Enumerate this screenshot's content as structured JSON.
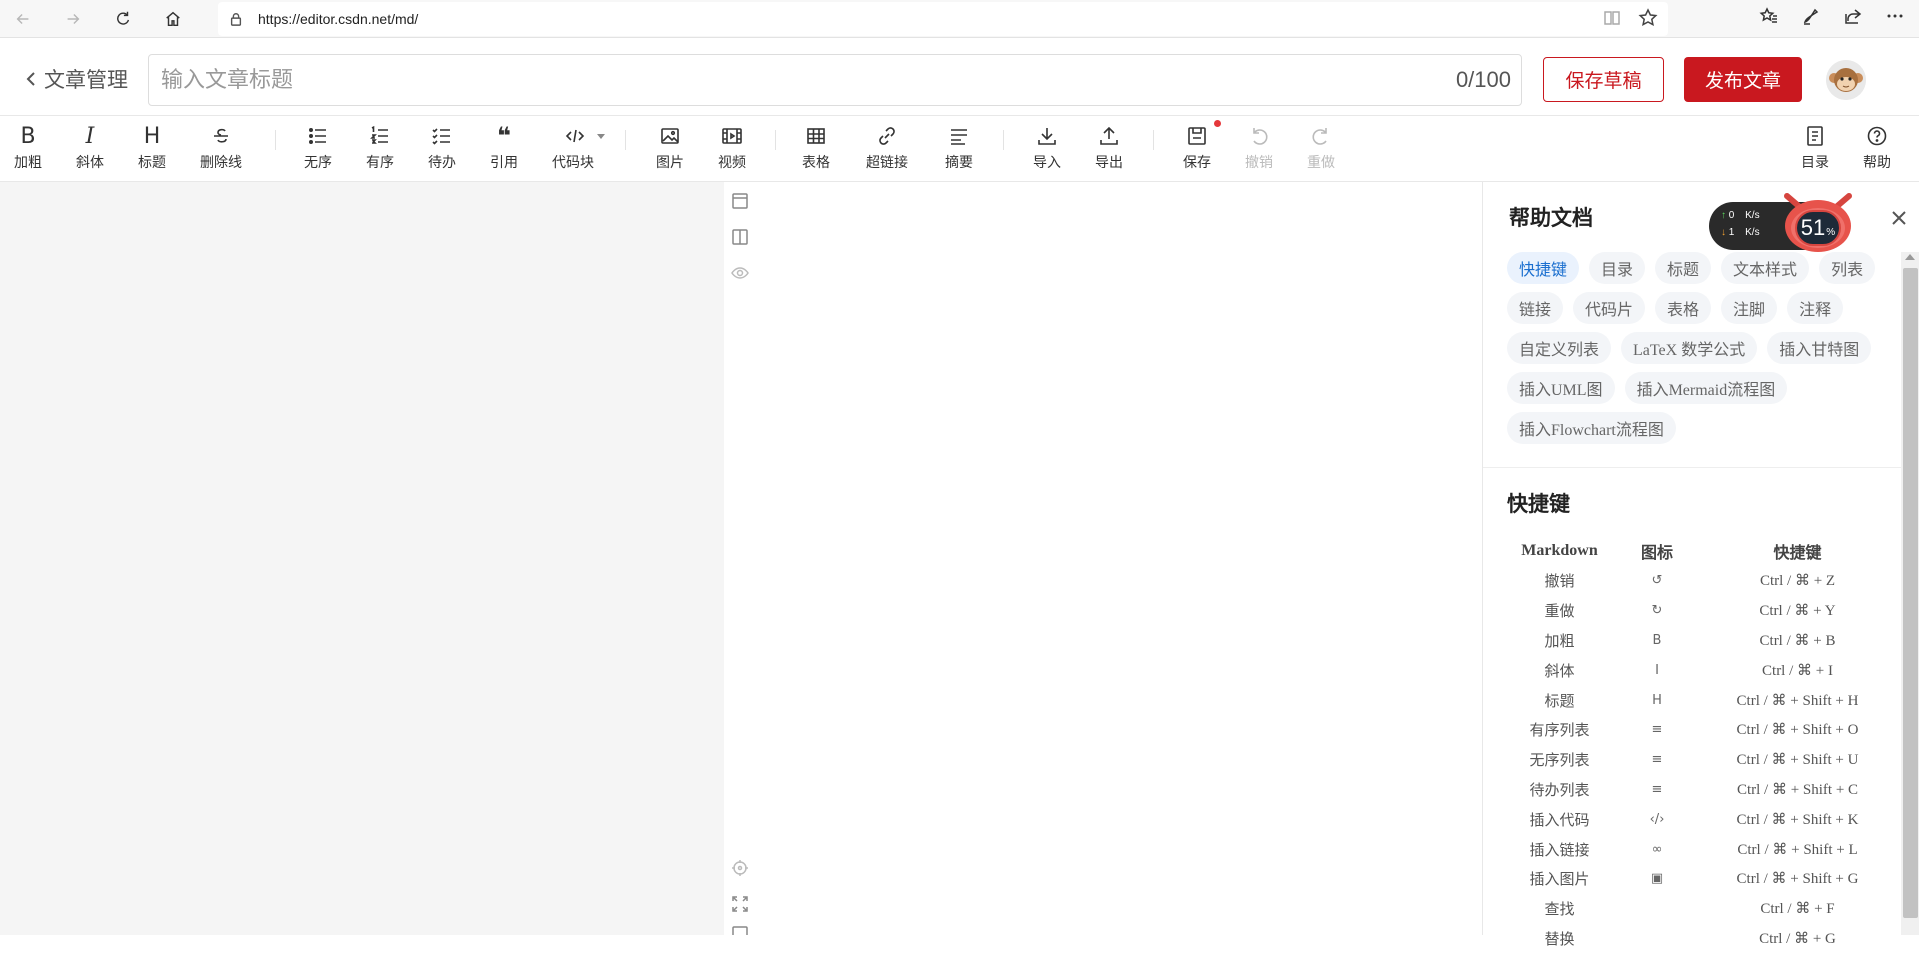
{
  "browser": {
    "url": "https://editor.csdn.net/md/"
  },
  "header": {
    "back_label": "文章管理",
    "title_placeholder": "输入文章标题",
    "title_count": "0/100",
    "save_draft": "保存草稿",
    "publish": "发布文章"
  },
  "toolbar": {
    "bold": "加粗",
    "italic": "斜体",
    "heading": "标题",
    "strike": "删除线",
    "unordered": "无序",
    "ordered": "有序",
    "todo": "待办",
    "quote": "引用",
    "code_block": "代码块",
    "image": "图片",
    "video": "视频",
    "table": "表格",
    "link": "超链接",
    "summary": "摘要",
    "import": "导入",
    "export": "导出",
    "save": "保存",
    "undo": "撤销",
    "redo": "重做",
    "toc": "目录",
    "help": "帮助"
  },
  "help": {
    "title": "帮助文档",
    "tags": [
      "快捷键",
      "目录",
      "标题",
      "文本样式",
      "列表",
      "链接",
      "代码片",
      "表格",
      "注脚",
      "注释",
      "自定义列表",
      "LaTeX 数学公式",
      "插入甘特图",
      "插入UML图",
      "插入Mermaid流程图",
      "插入Flowchart流程图"
    ],
    "shortcuts_title": "快捷键",
    "columns": [
      "Markdown",
      "图标",
      "快捷键"
    ],
    "rows": [
      [
        "撤销",
        "↺",
        "Ctrl / ⌘ + Z"
      ],
      [
        "重做",
        "↻",
        "Ctrl / ⌘ + Y"
      ],
      [
        "加粗",
        "B",
        "Ctrl / ⌘ + B"
      ],
      [
        "斜体",
        "I",
        "Ctrl / ⌘ + I"
      ],
      [
        "标题",
        "H",
        "Ctrl / ⌘ + Shift + H"
      ],
      [
        "有序列表",
        "≡",
        "Ctrl / ⌘ + Shift + O"
      ],
      [
        "无序列表",
        "≡",
        "Ctrl / ⌘ + Shift + U"
      ],
      [
        "待办列表",
        "≡",
        "Ctrl / ⌘ + Shift + C"
      ],
      [
        "插入代码",
        "‹/›",
        "Ctrl / ⌘ + Shift + K"
      ],
      [
        "插入链接",
        "∞",
        "Ctrl / ⌘ + Shift + L"
      ],
      [
        "插入图片",
        "▣",
        "Ctrl / ⌘ + Shift + G"
      ],
      [
        "查找",
        "",
        "Ctrl / ⌘ + F"
      ],
      [
        "替换",
        "",
        "Ctrl / ⌘ + G"
      ]
    ]
  },
  "speed": {
    "up": "0",
    "down": "1",
    "unit": "K/s",
    "percent": "51",
    "percent_sign": "%"
  }
}
